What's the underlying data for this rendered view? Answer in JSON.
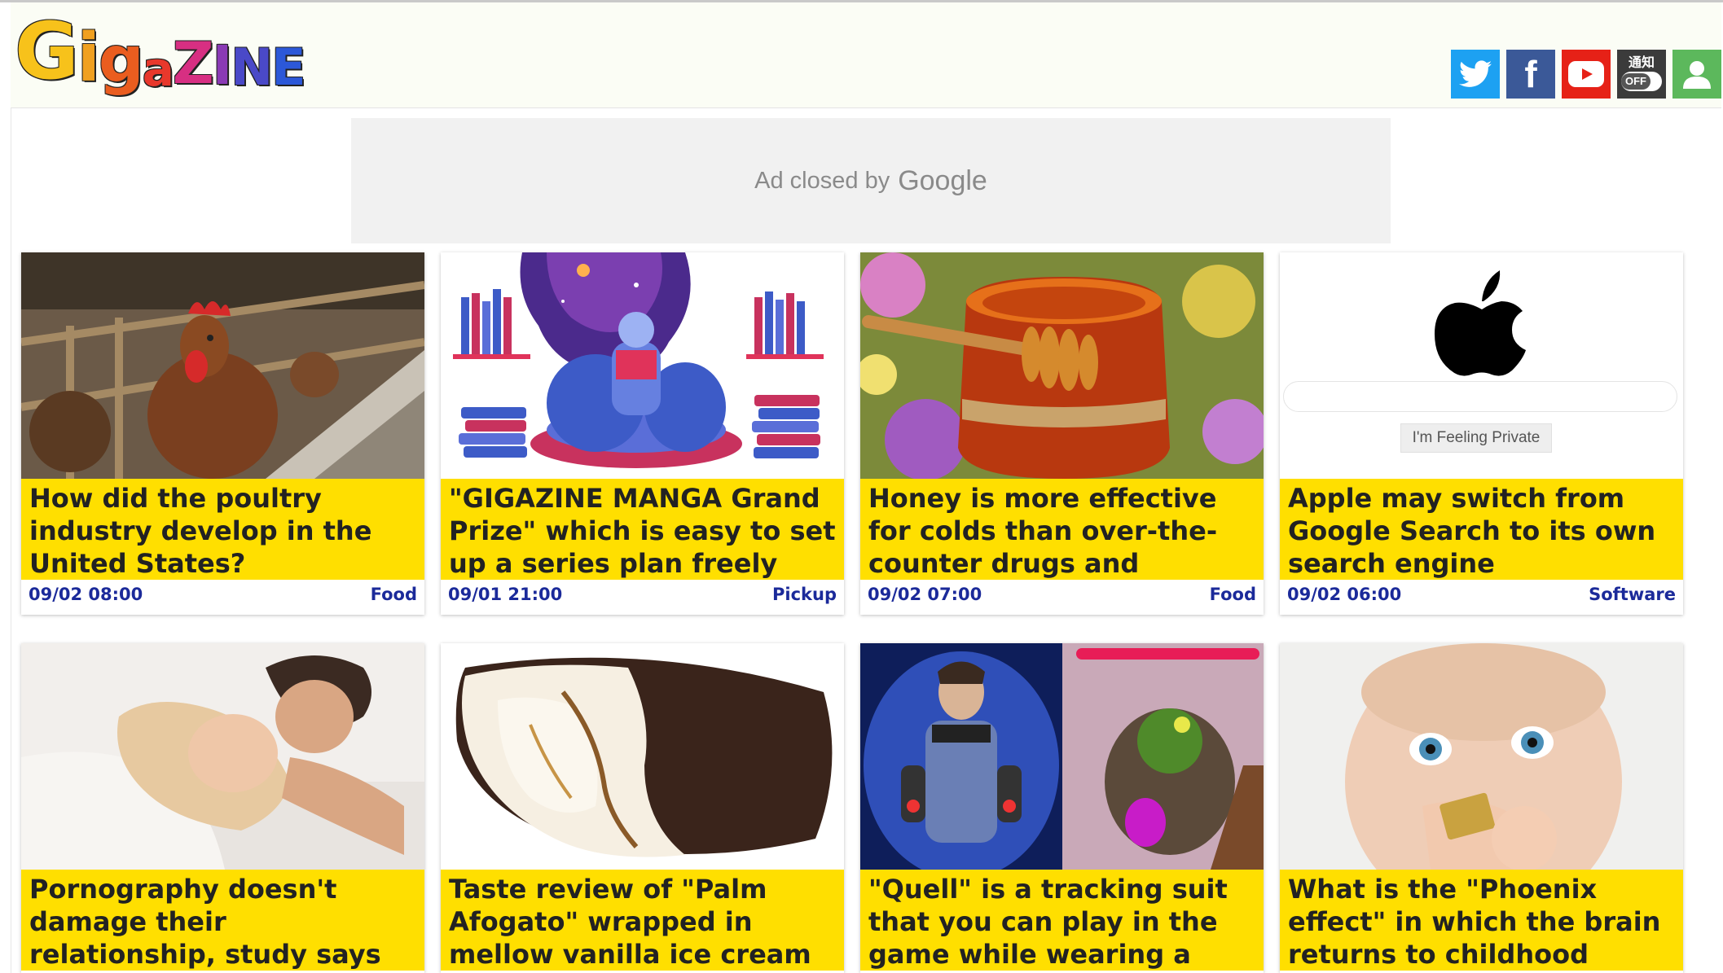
{
  "header": {
    "logo_letters": [
      "G",
      "i",
      "g",
      "a",
      "Z",
      "I",
      "N",
      "E"
    ],
    "social": {
      "twitter_icon": "twitter-icon",
      "facebook_glyph": "f",
      "youtube_icon": "youtube-icon",
      "notification_label": "通知",
      "notification_state": "OFF",
      "user_icon": "user-icon"
    }
  },
  "ad": {
    "text": "Ad closed by",
    "brand": "Google"
  },
  "articles": [
    {
      "title": "How did the poultry industry develop in the United States?",
      "date": "09/02 08:00",
      "category": "Food",
      "image": "hen-in-cage-photo"
    },
    {
      "title": "\"GIGAZINE MANGA Grand Prize\" which is easy to set up a series plan freely start",
      "date": "09/01 21:00",
      "category": "Pickup",
      "image": "reading-illustration"
    },
    {
      "title": "Honey is more effective for colds than over-the-counter drugs and antibiotics,",
      "date": "09/02 07:00",
      "category": "Food",
      "image": "honey-jar-photo"
    },
    {
      "title": "Apple may switch from Google Search to its own search engine",
      "date": "09/02 06:00",
      "category": "Software",
      "image": "apple-search-mockup",
      "search_button": "I'm Feeling Private"
    },
    {
      "title": "Pornography doesn't damage their relationship, study says",
      "image": "couple-photo"
    },
    {
      "title": "Taste review of \"Palm Afogato\" wrapped in mellow vanilla ice cream with crisp",
      "image": "ice-cream-bar-photo"
    },
    {
      "title": "\"Quell\" is a tracking suit that you can play in the game while wearing a ring-fit",
      "image": "tracking-suit-game-photo"
    },
    {
      "title": "What is the \"Phoenix effect\" in which the brain returns to childhood when given",
      "image": "baby-photo"
    }
  ],
  "colors": {
    "title_bg": "#ffdf00",
    "meta_text": "#1b2a9a",
    "twitter": "#1da1f2",
    "facebook": "#3b5998",
    "youtube": "#e62117",
    "user": "#5cb85c"
  }
}
